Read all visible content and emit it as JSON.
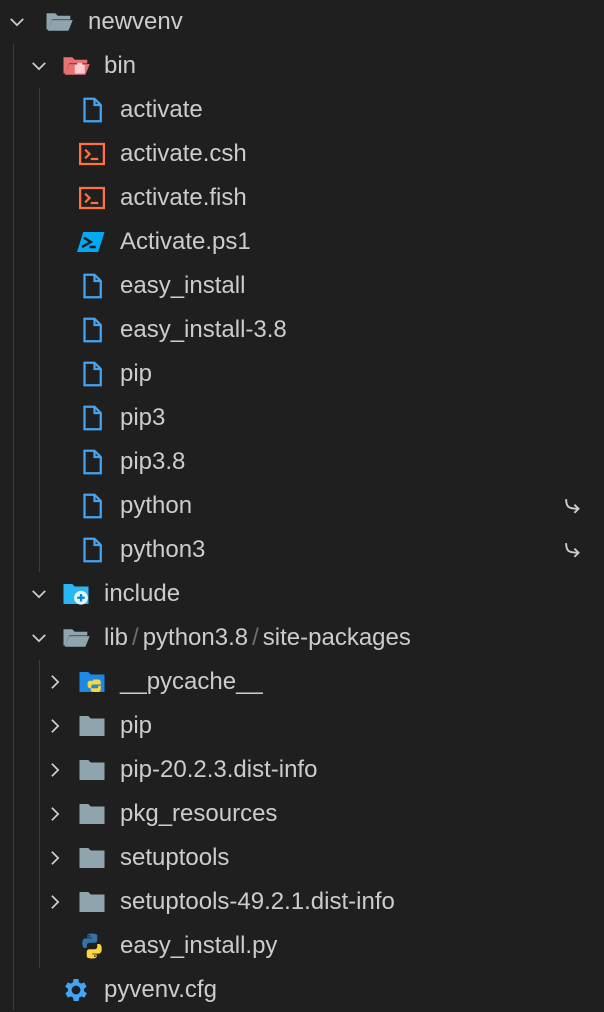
{
  "explorer": {
    "root": {
      "label": "newvenv",
      "icon": "folder-open-icon",
      "expanded": true
    },
    "bin": {
      "label": "bin",
      "icon": "folder-open-bin-icon",
      "expanded": true,
      "files": [
        {
          "label": "activate",
          "icon": "file-icon"
        },
        {
          "label": "activate.csh",
          "icon": "terminal-icon"
        },
        {
          "label": "activate.fish",
          "icon": "terminal-icon"
        },
        {
          "label": "Activate.ps1",
          "icon": "powershell-icon"
        },
        {
          "label": "easy_install",
          "icon": "file-icon"
        },
        {
          "label": "easy_install-3.8",
          "icon": "file-icon"
        },
        {
          "label": "pip",
          "icon": "file-icon"
        },
        {
          "label": "pip3",
          "icon": "file-icon"
        },
        {
          "label": "pip3.8",
          "icon": "file-icon"
        },
        {
          "label": "python",
          "icon": "file-icon",
          "symlink": true,
          "symlink_glyph": "↪"
        },
        {
          "label": "python3",
          "icon": "file-icon",
          "symlink": true,
          "symlink_glyph": "↪"
        }
      ]
    },
    "include": {
      "label": "include",
      "icon": "folder-include-icon",
      "expanded": false
    },
    "lib": {
      "segments": [
        "lib",
        "python3.8",
        "site-packages"
      ],
      "separator": "/",
      "icon": "folder-open-icon",
      "expanded": true,
      "children": [
        {
          "label": "__pycache__",
          "icon": "folder-python-icon",
          "expanded": false
        },
        {
          "label": "pip",
          "icon": "folder-icon",
          "expanded": false
        },
        {
          "label": "pip-20.2.3.dist-info",
          "icon": "folder-icon",
          "expanded": false
        },
        {
          "label": "pkg_resources",
          "icon": "folder-icon",
          "expanded": false
        },
        {
          "label": "setuptools",
          "icon": "folder-icon",
          "expanded": false
        },
        {
          "label": "setuptools-49.2.1.dist-info",
          "icon": "folder-icon",
          "expanded": false
        },
        {
          "label": "easy_install.py",
          "icon": "python-icon"
        }
      ]
    },
    "cfg": {
      "label": "pyvenv.cfg",
      "icon": "gear-icon"
    }
  },
  "colors": {
    "background": "#1f1f1f",
    "text": "#cccccc",
    "folder": "#90a4ae",
    "file_blue": "#42a5f5",
    "terminal_orange": "#ff7043",
    "bin_red": "#e57373",
    "gear_blue": "#42a5f5",
    "python_blue": "#3572a5",
    "python_yellow": "#ffd43b"
  }
}
